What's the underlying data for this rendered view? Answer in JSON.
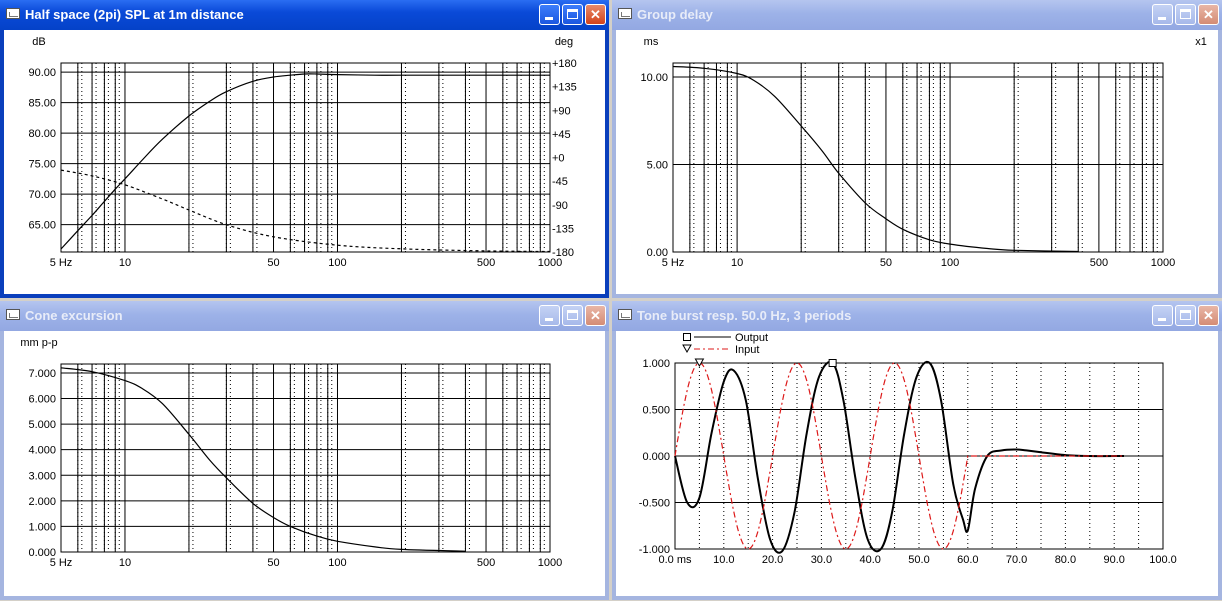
{
  "windows": [
    {
      "id": "spl",
      "title": "Half space (2pi) SPL at 1m distance",
      "active": true,
      "chart_data": {
        "type": "line",
        "x_scale": "log",
        "xlim": [
          5,
          1000
        ],
        "x_ticks": [
          5,
          10,
          50,
          100,
          500,
          1000
        ],
        "x_tick_labels": [
          "5 Hz",
          "10",
          "50",
          "100",
          "500",
          "1000"
        ],
        "ylim": [
          60.5,
          91.5
        ],
        "y_ticks": [
          65,
          70,
          75,
          80,
          85,
          90
        ],
        "y_tick_labels": [
          "65.00",
          "70.00",
          "75.00",
          "80.00",
          "85.00",
          "90.00"
        ],
        "ylabel": "dB",
        "y2label": "deg",
        "y2lim": [
          -180,
          180
        ],
        "y2_ticks": [
          -180,
          -135,
          -90,
          -45,
          0,
          45,
          90,
          135,
          180
        ],
        "y2_tick_labels": [
          "-180",
          "-135",
          "-90",
          "-45",
          "+0",
          "+45",
          "+90",
          "+135",
          "+180"
        ],
        "grid": true,
        "series": [
          {
            "style": "solid",
            "axis": "left",
            "x": [
              5,
              6,
              7,
              8,
              9,
              10,
              12,
              15,
              20,
              25,
              30,
              40,
              50,
              60,
              70,
              80,
              100,
              150,
              200,
              500,
              1000
            ],
            "y": [
              61.0,
              64.0,
              66.5,
              68.8,
              70.8,
              72.5,
              75.5,
              79.0,
              82.8,
              85.2,
              86.8,
              88.5,
              89.2,
              89.5,
              89.7,
              89.7,
              89.6,
              89.5,
              89.5,
              89.5,
              89.5
            ]
          },
          {
            "style": "dashed",
            "axis": "right",
            "x": [
              5,
              7,
              10,
              15,
              20,
              30,
              50,
              100,
              200,
              500,
              1000
            ],
            "y": [
              -24,
              -35,
              -52,
              -79,
              -100,
              -128,
              -151,
              -167,
              -174,
              -178,
              -179
            ]
          }
        ]
      }
    },
    {
      "id": "gd",
      "title": "Group delay",
      "active": false,
      "chart_data": {
        "type": "line",
        "x_scale": "log",
        "xlim": [
          5,
          1000
        ],
        "x_ticks": [
          5,
          10,
          50,
          100,
          500,
          1000
        ],
        "x_tick_labels": [
          "5 Hz",
          "10",
          "50",
          "100",
          "500",
          "1000"
        ],
        "ylim": [
          0,
          10.8
        ],
        "y_ticks": [
          0,
          5,
          10
        ],
        "y_tick_labels": [
          "0.00",
          "5.00",
          "10.00"
        ],
        "ylabel": "ms",
        "y2label": "x1",
        "grid": true,
        "series": [
          {
            "style": "solid",
            "axis": "left",
            "x": [
              5,
              7,
              10,
              12,
              15,
              20,
              25,
              30,
              40,
              50,
              60,
              80,
              100,
              150,
              200,
              400
            ],
            "y": [
              10.6,
              10.5,
              10.2,
              9.8,
              8.9,
              7.2,
              5.8,
              4.5,
              2.8,
              1.9,
              1.3,
              0.7,
              0.45,
              0.2,
              0.1,
              0.03
            ]
          }
        ]
      }
    },
    {
      "id": "cone",
      "title": "Cone excursion",
      "active": false,
      "chart_data": {
        "type": "line",
        "x_scale": "log",
        "xlim": [
          5,
          1000
        ],
        "x_ticks": [
          5,
          10,
          50,
          100,
          500,
          1000
        ],
        "x_tick_labels": [
          "5 Hz",
          "10",
          "50",
          "100",
          "500",
          "1000"
        ],
        "ylim": [
          0,
          7.35
        ],
        "y_ticks": [
          0,
          1,
          2,
          3,
          4,
          5,
          6,
          7
        ],
        "y_tick_labels": [
          "0.000",
          "1.000",
          "2.000",
          "3.000",
          "4.000",
          "5.000",
          "6.000",
          "7.000"
        ],
        "ylabel": "mm p-p",
        "grid": true,
        "series": [
          {
            "style": "solid",
            "axis": "left",
            "x": [
              5,
              7,
              10,
              12,
              15,
              20,
              25,
              30,
              40,
              50,
              60,
              80,
              100,
              150,
              200,
              400
            ],
            "y": [
              7.2,
              7.05,
              6.7,
              6.4,
              5.8,
              4.6,
              3.6,
              2.9,
              1.9,
              1.35,
              1.0,
              0.62,
              0.42,
              0.2,
              0.1,
              0.03
            ]
          }
        ]
      }
    },
    {
      "id": "burst",
      "title": "Tone burst resp. 50.0 Hz, 3 periods",
      "active": false,
      "chart_data": {
        "type": "line",
        "x_scale": "linear",
        "xlim": [
          0,
          100
        ],
        "x_ticks": [
          0,
          10,
          20,
          30,
          40,
          50,
          60,
          70,
          80,
          90,
          100
        ],
        "x_tick_labels": [
          "0.0 ms",
          "10.0",
          "20.0",
          "30.0",
          "40.0",
          "50.0",
          "60.0",
          "70.0",
          "80.0",
          "90.0",
          "100.0"
        ],
        "ylim": [
          -1.0,
          1.0
        ],
        "y_ticks": [
          -1,
          -0.5,
          0,
          0.5,
          1
        ],
        "y_tick_labels": [
          "-1.000",
          "-0.500",
          "0.000",
          "0.500",
          "1.000"
        ],
        "grid": true,
        "legend": "top-left",
        "series": [
          {
            "name": "Output",
            "style": "solid",
            "marker": "square",
            "marker_x": 32.3,
            "marker_y": 1.0,
            "x": [
              0,
              2.5,
              5,
              7.5,
              10,
              12,
              14.5,
              17,
              19.5,
              22,
              24.5,
              27,
              29.5,
              32.3,
              34.5,
              37,
              39.5,
              42.2,
              44.5,
              47,
              49.5,
              52.2,
              54.5,
              57,
              59,
              60,
              61.5,
              64,
              67,
              70,
              72,
              75,
              80,
              85,
              92
            ],
            "y": [
              0,
              -0.5,
              -0.45,
              0.25,
              0.8,
              0.92,
              0.6,
              -0.25,
              -0.9,
              -1.02,
              -0.6,
              0.25,
              0.85,
              1.0,
              0.6,
              -0.25,
              -0.9,
              -1.0,
              -0.6,
              0.25,
              0.85,
              1.0,
              0.6,
              -0.3,
              -0.68,
              -0.8,
              -0.35,
              0.0,
              0.06,
              0.07,
              0.06,
              0.04,
              0.01,
              0.0,
              0.0
            ]
          },
          {
            "name": "Input",
            "style": "dashdot",
            "color": "#dd1a1a",
            "marker": "triangle",
            "marker_x": 5,
            "marker_y": 1.0,
            "sine": {
              "freq_per_ms": 0.05,
              "start": 0,
              "end": 60,
              "amp": 1.0
            }
          }
        ]
      }
    }
  ]
}
